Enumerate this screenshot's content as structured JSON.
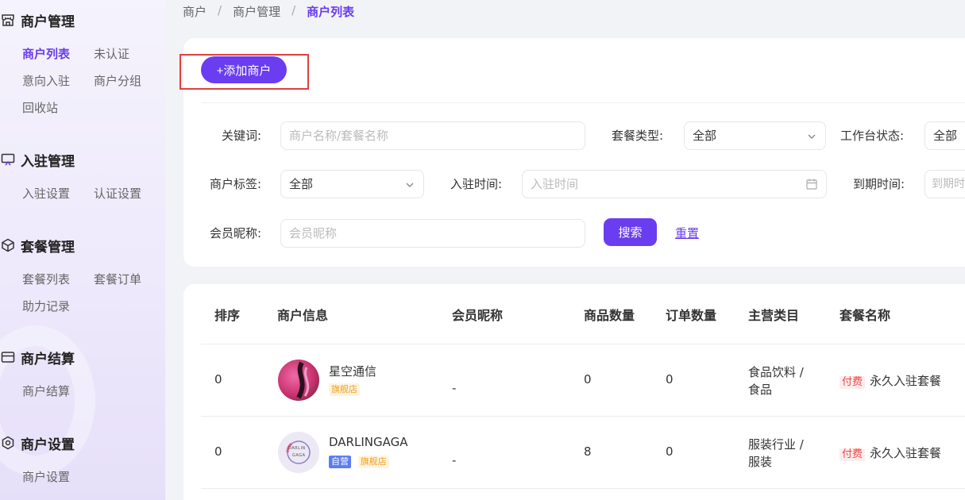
{
  "sidebar": {
    "groups": [
      {
        "title": "商户管理",
        "icon": "store-icon",
        "items": [
          "商户列表",
          "未认证",
          "意向入驻",
          "商户分组",
          "回收站"
        ]
      },
      {
        "title": "入驻管理",
        "icon": "display-icon",
        "items": [
          "入驻设置",
          "认证设置"
        ]
      },
      {
        "title": "套餐管理",
        "icon": "cube-icon",
        "items": [
          "套餐列表",
          "套餐订单",
          "助力记录"
        ]
      },
      {
        "title": "商户结算",
        "icon": "wallet-icon",
        "items": [
          "商户结算"
        ]
      },
      {
        "title": "商户设置",
        "icon": "gear-icon",
        "items": [
          "商户设置"
        ]
      }
    ],
    "active_item": "商户列表"
  },
  "breadcrumb": [
    "商户",
    "商户管理",
    "商户列表"
  ],
  "add_button": "+添加商户",
  "filters": {
    "keyword_label": "关键词:",
    "keyword_placeholder": "商户名称/套餐名称",
    "plan_type_label": "套餐类型:",
    "plan_type_value": "全部",
    "workbench_label": "工作台状态:",
    "workbench_value": "全部",
    "tag_label": "商户标签:",
    "tag_value": "全部",
    "join_time_label": "入驻时间:",
    "join_time_placeholder": "入驻时间",
    "expire_label": "到期时间:",
    "expire_placeholder": "到期时间",
    "nickname_label": "会员昵称:",
    "nickname_placeholder": "会员昵称",
    "search_button": "搜索",
    "reset_link": "重置"
  },
  "table": {
    "headers": [
      "排序",
      "商户信息",
      "会员昵称",
      "商品数量",
      "订单数量",
      "主营类目",
      "套餐名称"
    ],
    "rows": [
      {
        "sort": "0",
        "name": "星空通信",
        "tags": [
          "旗舰店"
        ],
        "nickname": "-",
        "goods": "0",
        "orders": "0",
        "category_1": "食品饮料 /",
        "category_2": "食品",
        "plan_tag": "付费",
        "plan": "永久入驻套餐"
      },
      {
        "sort": "0",
        "name": "DARLINGAGA",
        "tags": [
          "自营",
          "旗舰店"
        ],
        "avatar_text_1": "DARLIN",
        "avatar_text_2": "GAGA",
        "nickname": "-",
        "goods": "8",
        "orders": "0",
        "category_1": "服装行业 /",
        "category_2": "服装",
        "plan_tag": "付费",
        "plan": "永久入驻套餐"
      }
    ]
  },
  "colors": {
    "accent": "#6a3df0",
    "highlight_box": "#e0403f"
  }
}
